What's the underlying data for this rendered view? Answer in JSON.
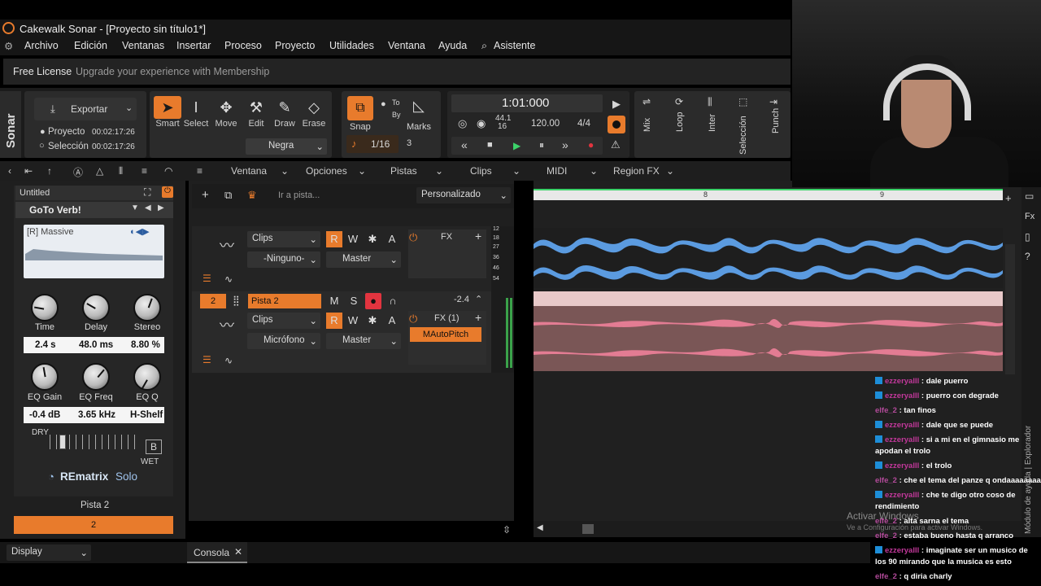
{
  "window": {
    "title": "Cakewalk Sonar - [Proyecto sin título1*]"
  },
  "menu": {
    "items": [
      "Archivo",
      "Edición",
      "Ventanas",
      "Insertar",
      "Proceso",
      "Proyecto",
      "Utilidades",
      "Ventana",
      "Ayuda",
      "Asistente"
    ]
  },
  "license": {
    "label": "Free License",
    "upgrade": "Upgrade your experience with Membership"
  },
  "toolbar": {
    "brand": "Sonar",
    "export_label": "Exportar",
    "project_label": "Proyecto",
    "project_time": "00:02:17:26",
    "selection_label": "Selección",
    "selection_time": "00:02:17:26",
    "tools": [
      "Smart",
      "Select",
      "Move",
      "Edit",
      "Draw",
      "Erase"
    ],
    "color_select": "Negra",
    "snap_label": "Snap",
    "to_label": "To",
    "by_label": "By",
    "marks_label": "Marks",
    "snap_value": "1/16",
    "snap_count": "3",
    "transport_time": "1:01:000",
    "sample_rate": "44.1",
    "bit_depth": "16",
    "tempo": "120.00",
    "meter": "4/4",
    "right_panels": [
      "Mix",
      "Loop",
      "Inter",
      "Selección",
      "Punch"
    ]
  },
  "secbar": {
    "items": [
      "Ventana",
      "Opciones",
      "Pistas",
      "Clips",
      "MIDI",
      "Region FX"
    ],
    "goto_placeholder": "Ir a pista...",
    "preset": "Personalizado"
  },
  "timeline": {
    "markers": [
      "8",
      "9"
    ]
  },
  "plugin": {
    "header": "Untitled",
    "preset_name": "GoTo Verb!",
    "preset": "[R] Massive",
    "knobs_row1": [
      "Time",
      "Delay",
      "Stereo"
    ],
    "values_row1": [
      "2.4 s",
      "48.0 ms",
      "8.80 %"
    ],
    "knobs_row2": [
      "EQ Gain",
      "EQ Freq",
      "EQ Q"
    ],
    "values_row2": [
      "-0.4 dB",
      "3.65 kHz",
      "H-Shelf"
    ],
    "dry": "DRY",
    "wet": "WET",
    "b_label": "B",
    "brand": "REmatrix",
    "brand2": "Solo",
    "track_name": "Pista 2",
    "track_number": "2",
    "display": "Display"
  },
  "tracks": {
    "track1": {
      "clips": "Clips",
      "input": "-Ninguno-",
      "output": "Master",
      "fx": "FX"
    },
    "track2": {
      "number": "2",
      "name": "Pista 2",
      "volume": "-2.4",
      "clips": "Clips",
      "input": "Micrófono",
      "output": "Master",
      "fx": "FX (1)",
      "plugin": "MAutoPitch"
    },
    "meter_scale": [
      "12",
      "18",
      "27",
      "36",
      "46",
      "54"
    ]
  },
  "console_tab": "Consola",
  "watermark": {
    "line1": "Activar Windows",
    "line2": "Ve a Configuración para activar Windows."
  },
  "side_label": "Módulo de ayuda | Explorador",
  "chat": [
    {
      "user": "ezzeryalll",
      "msg": "dale puerro",
      "badge": true
    },
    {
      "user": "ezzeryalll",
      "msg": "puerro con degrade",
      "badge": true
    },
    {
      "user": "elfe_2",
      "msg": "tan finos",
      "badge": false
    },
    {
      "user": "ezzeryalll",
      "msg": "dale que se puede",
      "badge": true
    },
    {
      "user": "ezzeryalll",
      "msg": "si a mi en el gimnasio me apodan el trolo",
      "badge": true
    },
    {
      "user": "ezzeryalll",
      "msg": "el trolo",
      "badge": true
    },
    {
      "user": "elfe_2",
      "msg": "che el tema del panze q ondaaaaaaaa",
      "badge": false
    },
    {
      "user": "ezzeryalll",
      "msg": "che te digo otro coso de rendimiento",
      "badge": true
    },
    {
      "user": "elfe_2",
      "msg": "alta sarna el tema",
      "badge": false
    },
    {
      "user": "elfe_2",
      "msg": "estaba bueno hasta q arranco",
      "badge": false
    },
    {
      "user": "ezzeryalll",
      "msg": "imaginate ser un musico de los 90 mirando que la musica es esto",
      "badge": true
    },
    {
      "user": "elfe_2",
      "msg": "q diria charly",
      "badge": false
    }
  ]
}
